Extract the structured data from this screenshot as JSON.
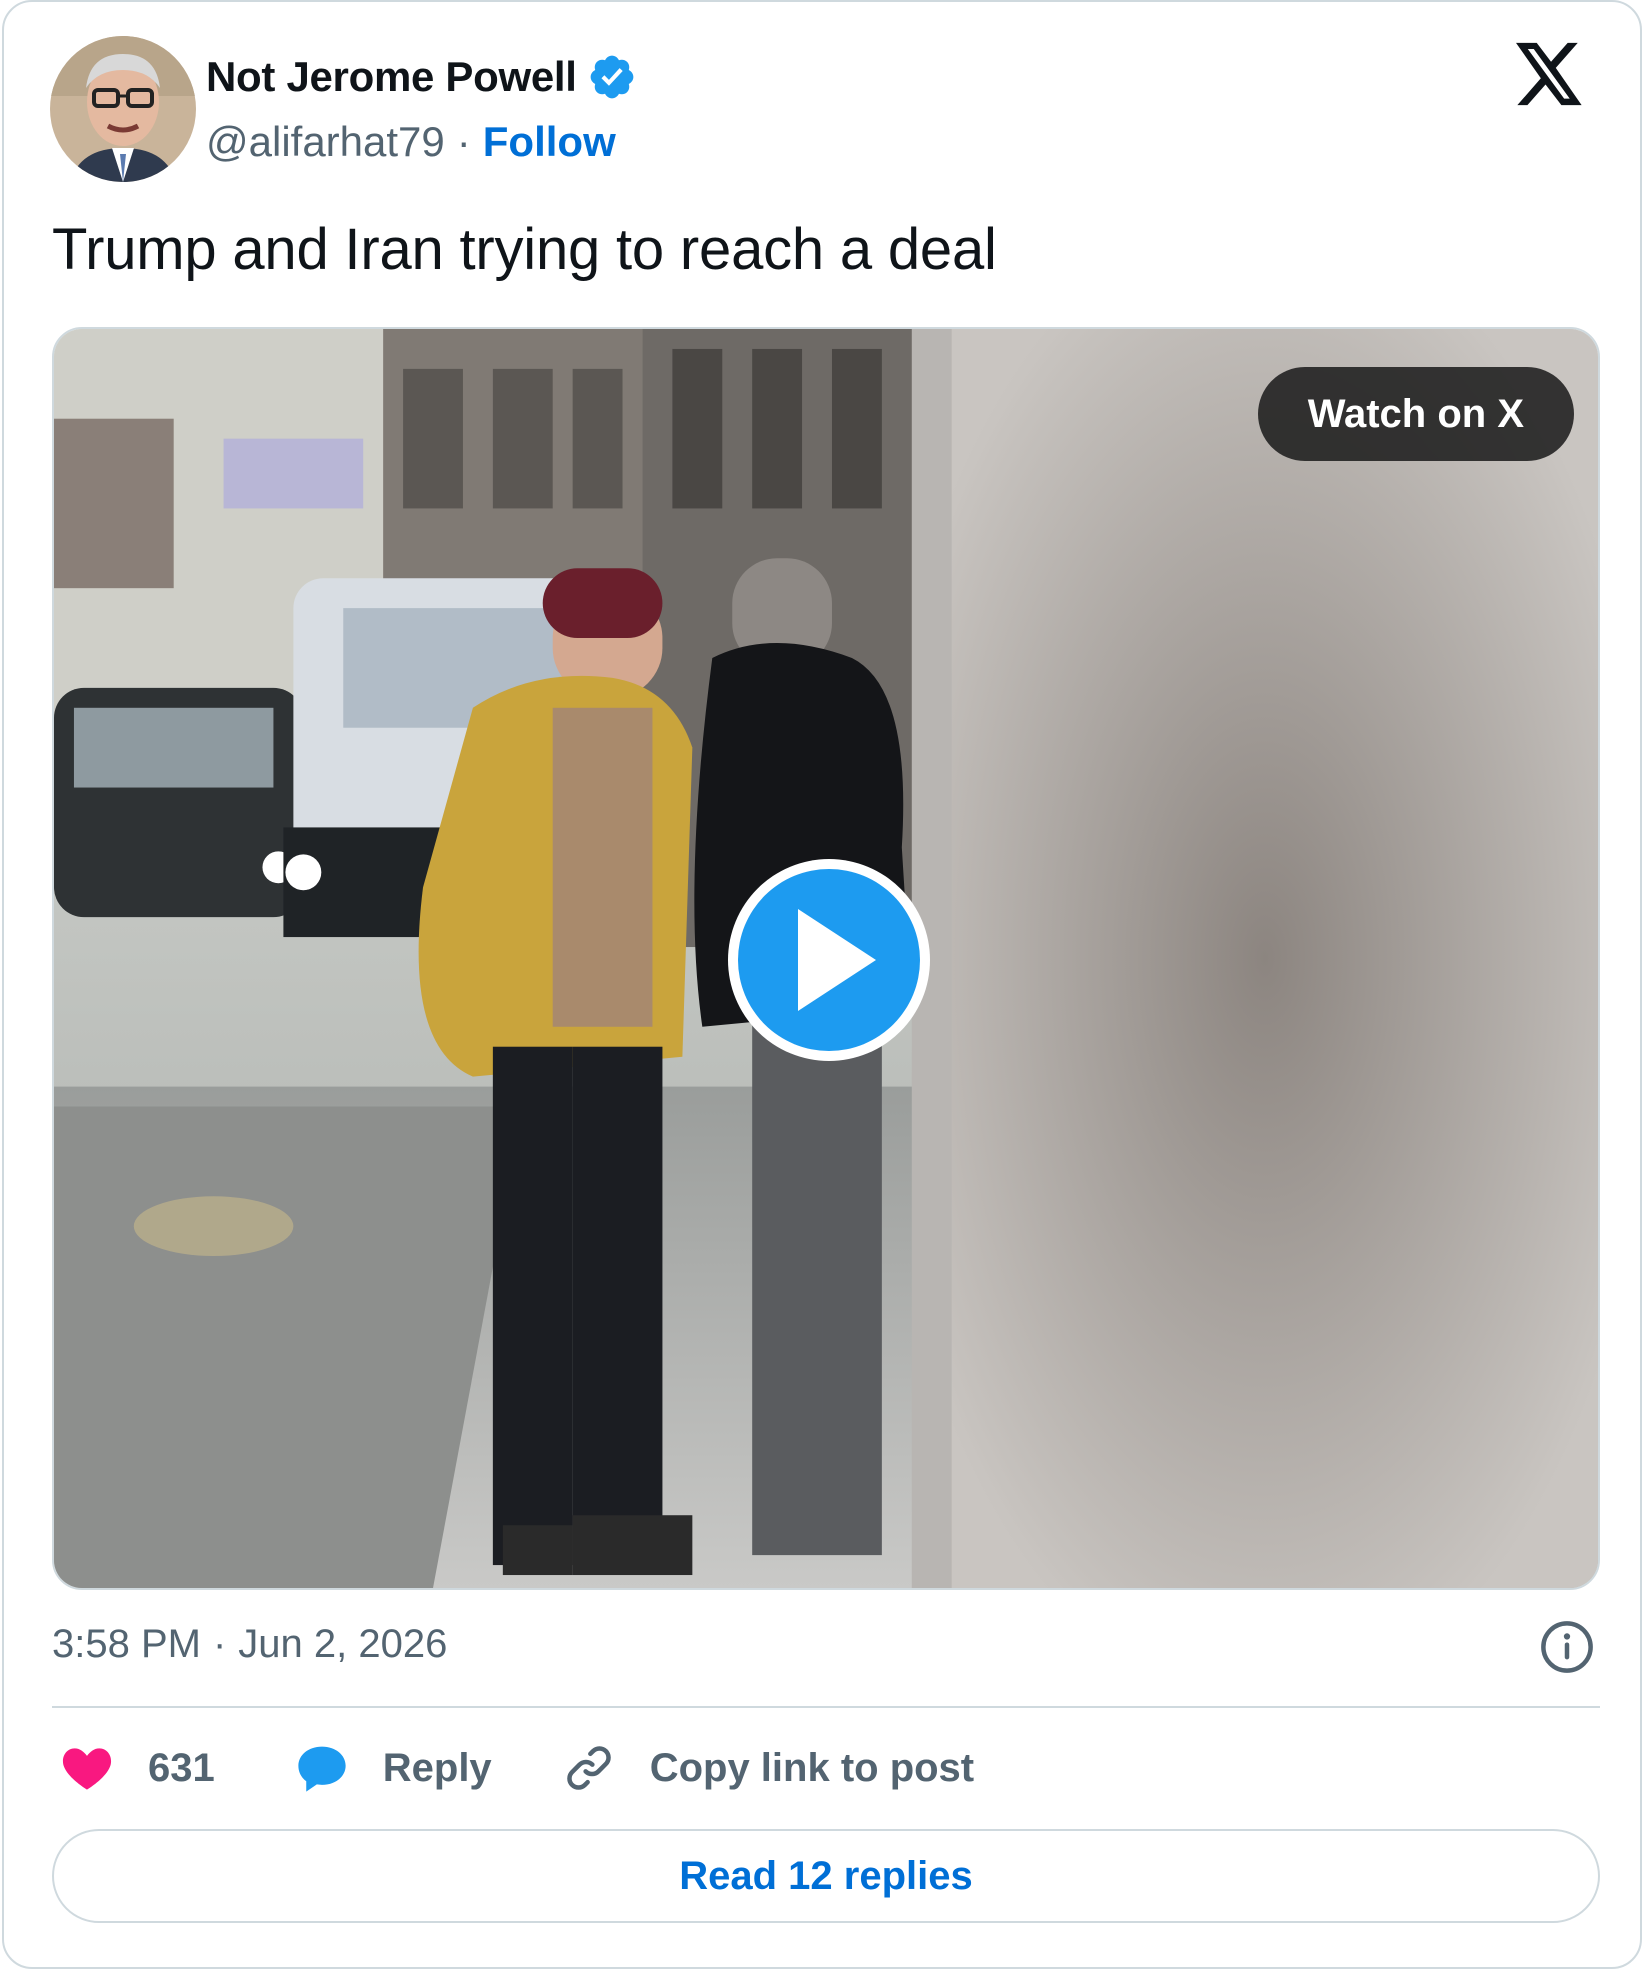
{
  "author": {
    "name": "Not Jerome Powell",
    "handle": "@alifarhat79",
    "separator": "·",
    "follow_label": "Follow",
    "verified": true,
    "avatar_icon": "profile-photo"
  },
  "tweet": {
    "text": "Trump and Iran trying to reach a deal",
    "time": "3:58 PM",
    "separator": "·",
    "date": "Jun 2, 2026"
  },
  "media": {
    "type": "video",
    "watch_label": "Watch on X",
    "play_icon": "play-icon"
  },
  "actions": {
    "like_count": "631",
    "reply_label": "Reply",
    "copy_label": "Copy link to post"
  },
  "read_replies_label": "Read 12 replies",
  "colors": {
    "accent_blue": "#1d9bf0",
    "link_blue": "#006fd6",
    "like_pink": "#f91880",
    "muted_text": "#536471",
    "border": "#cfd9de"
  }
}
